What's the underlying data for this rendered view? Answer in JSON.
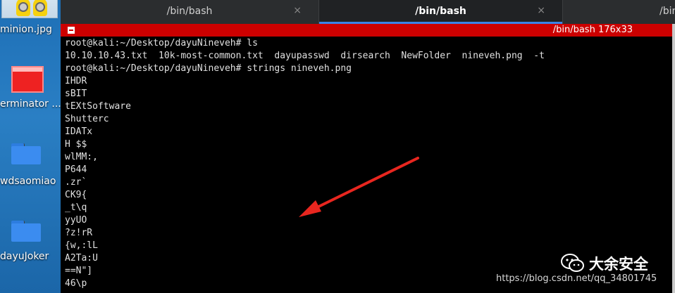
{
  "desktop": {
    "icons": [
      {
        "label": "minion.jpg",
        "icon": "image-thumbnail-icon"
      },
      {
        "label": "erminator ...",
        "icon": "terminator-app-icon"
      },
      {
        "label": "wdsaomiao",
        "icon": "folder-icon"
      },
      {
        "label": "dayuJoker",
        "icon": "folder-icon"
      }
    ]
  },
  "tabs": [
    {
      "title": "/bin/bash",
      "close": "×"
    },
    {
      "title": "/bin/bash",
      "close": "×"
    },
    {
      "title": "/bin"
    }
  ],
  "window": {
    "title": "/bin/bash 176x33"
  },
  "terminal": {
    "lines": [
      "root@kali:~/Desktop/dayuNineveh# ls",
      "10.10.10.43.txt  10k-most-common.txt  dayupasswd  dirsearch  NewFolder  nineveh.png  -t",
      "root@kali:~/Desktop/dayuNineveh# strings nineveh.png",
      "IHDR",
      "sBIT",
      "tEXtSoftware",
      "Shutterc",
      "IDATx",
      "H $$",
      "wlMM:,",
      "P644",
      ".zr`",
      "CK9{",
      "_t\\q",
      "yyUO",
      "?z!rR",
      "{w,:lL",
      "A2Ta:U",
      "==N\"]",
      "46\\p"
    ]
  },
  "annotation": {
    "arrow_color": "#e8261f"
  },
  "watermark": {
    "name": "大余安全",
    "url": "https://blog.csdn.net/qq_34801745"
  }
}
